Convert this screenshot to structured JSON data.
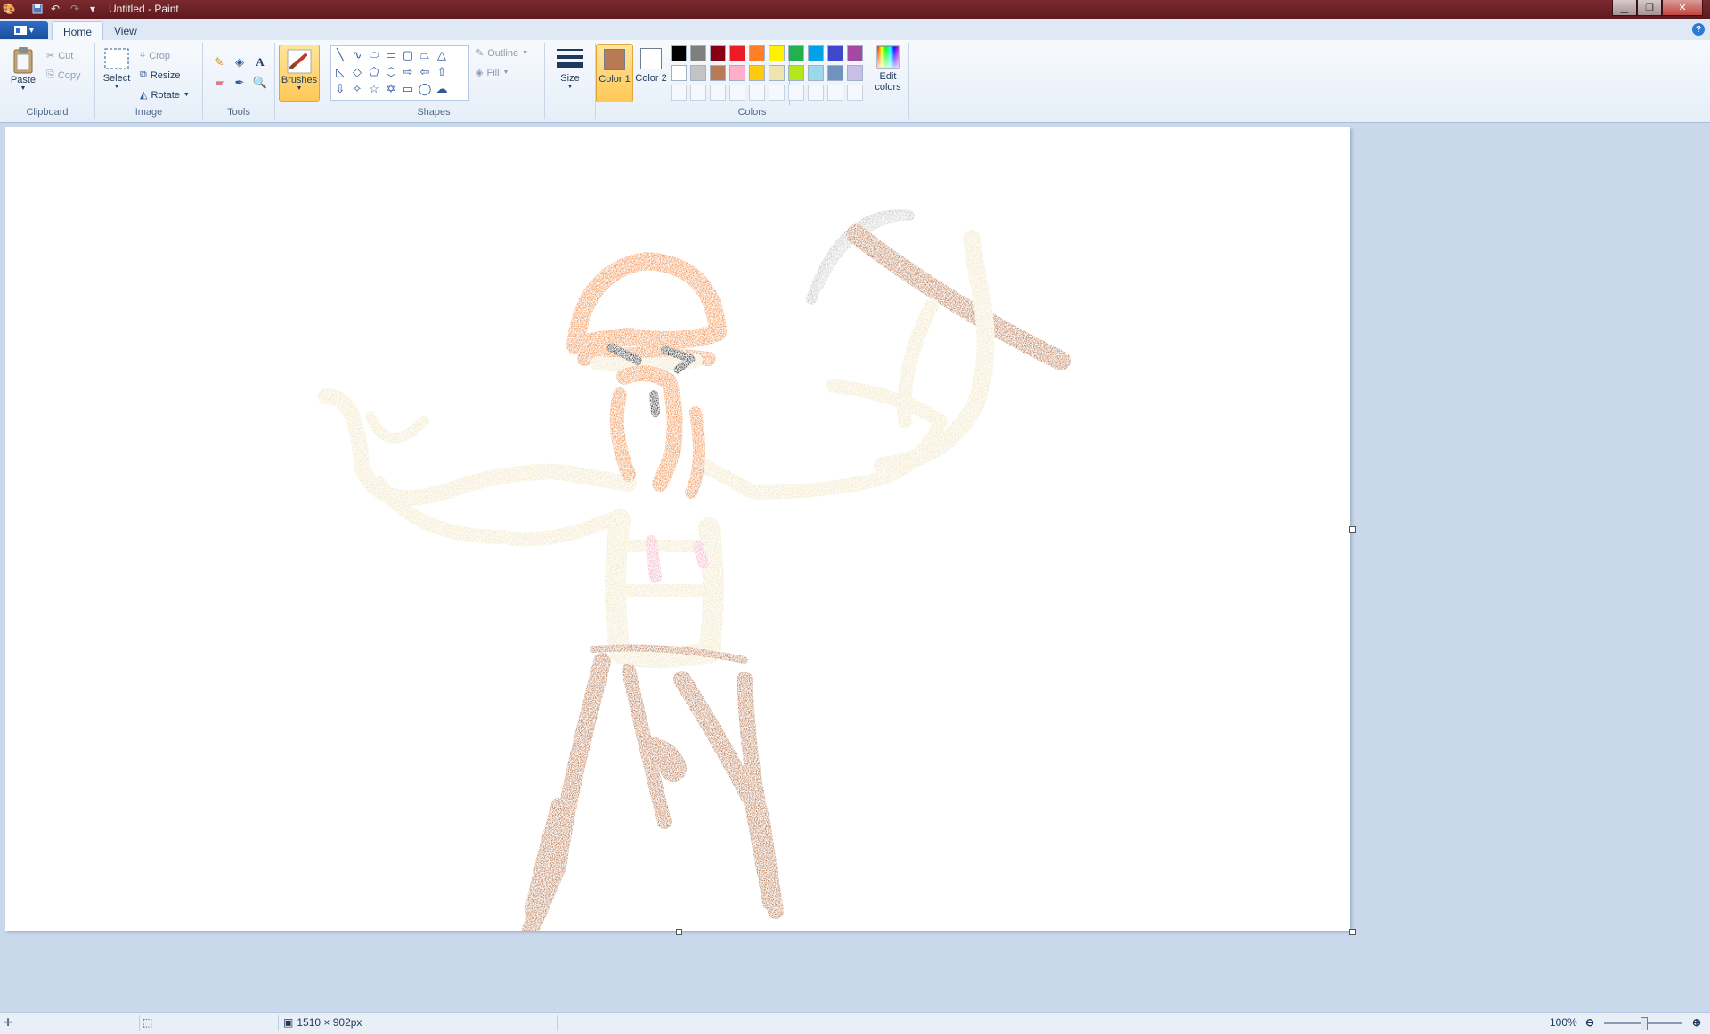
{
  "window": {
    "title": "Untitled - Paint"
  },
  "tabs": [
    {
      "label": "Home"
    },
    {
      "label": "View"
    }
  ],
  "ribbon": {
    "clipboard": {
      "label": "Clipboard",
      "paste": "Paste",
      "cut": "Cut",
      "copy": "Copy"
    },
    "image": {
      "label": "Image",
      "select": "Select",
      "crop": "Crop",
      "resize": "Resize",
      "rotate": "Rotate"
    },
    "tools": {
      "label": "Tools"
    },
    "brushes": {
      "label": "Brushes"
    },
    "shapes": {
      "label": "Shapes",
      "outline": "Outline",
      "fill": "Fill"
    },
    "size": {
      "label": "Size"
    },
    "colors": {
      "label": "Colors",
      "color1_label": "Color 1",
      "color2_label": "Color 2",
      "color1_value": "#b87a54",
      "color2_value": "#ffffff",
      "edit_colors": "Edit colors",
      "palette_row1": [
        "#000000",
        "#7f7f7f",
        "#880015",
        "#ed1c24",
        "#ff7f27",
        "#fff200",
        "#22b14c",
        "#00a2e8",
        "#3f48cc",
        "#a349a4"
      ],
      "palette_row2": [
        "#ffffff",
        "#c3c3c3",
        "#b97a57",
        "#ffaec9",
        "#ffc90e",
        "#efe4b0",
        "#b5e61d",
        "#99d9ea",
        "#7092be",
        "#c8bfe7"
      ]
    }
  },
  "status": {
    "canvas_size": "1510 × 902px",
    "zoom": "100%"
  }
}
